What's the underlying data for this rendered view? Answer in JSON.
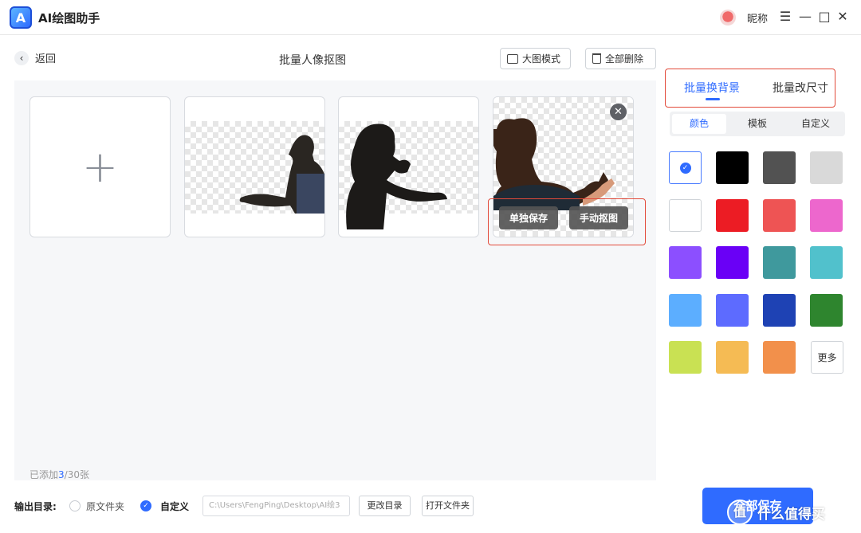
{
  "app": {
    "title": "AI绘图助手",
    "logo_letter": "A",
    "nickname": "昵称"
  },
  "window_controls": {
    "menu": "☰",
    "minimize": "—",
    "maximize": "□",
    "close": "✕"
  },
  "subheader": {
    "back_label": "返回",
    "page_title": "批量人像抠图",
    "big_mode_label": "大图模式",
    "delete_all_label": "全部删除"
  },
  "images": {
    "add_symbol": "+",
    "cards": [
      {
        "subject": "man-side-profile"
      },
      {
        "subject": "woman-drinking"
      },
      {
        "subject": "woman-from-back",
        "close": "✕",
        "save_single": "单独保存",
        "manual_cut": "手动抠图"
      }
    ]
  },
  "status": {
    "count_prefix": "已添加",
    "count_current": "3",
    "count_suffix": "/30张"
  },
  "right_panel": {
    "tabs": [
      {
        "label": "批量换背景",
        "active": true
      },
      {
        "label": "批量改尺寸",
        "active": false
      }
    ],
    "segments": [
      {
        "label": "颜色",
        "active": true
      },
      {
        "label": "模板"
      },
      {
        "label": "自定义"
      }
    ],
    "colors": [
      "#ffffff",
      "#000000",
      "#525252",
      "#d9d9d9",
      "#ffffff",
      "#ec1c24",
      "#ee5454",
      "#ed67cd",
      "#8c4fff",
      "#6a00f6",
      "#3f999d",
      "#51c1cc",
      "#5caeff",
      "#5d6bff",
      "#1e42b4",
      "#2e852e",
      "#c9e153",
      "#f5bb54",
      "#f2904b"
    ],
    "selected_color_index": 0,
    "more_label": "更多"
  },
  "bottom": {
    "output_label": "输出目录:",
    "option_original": "原文件夹",
    "option_custom": "自定义",
    "path_value": "C:\\Users\\FengPing\\Desktop\\AI绘3",
    "change_dir_label": "更改目录",
    "open_folder_label": "打开文件夹",
    "save_all_label": "全部保存",
    "watermark_text": "什么值得买",
    "watermark_badge": "值"
  }
}
